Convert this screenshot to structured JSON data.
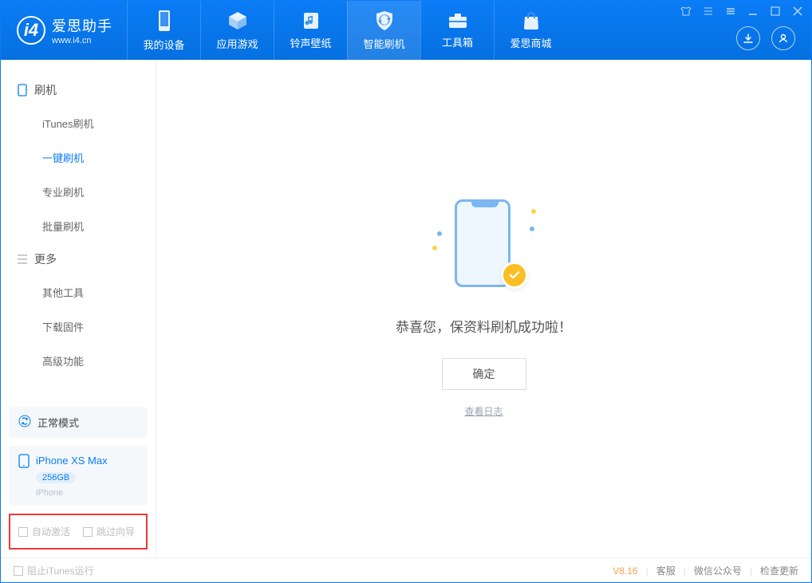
{
  "app": {
    "name_cn": "爱思助手",
    "name_en": "www.i4.cn"
  },
  "nav": {
    "device": "我的设备",
    "apps": "应用游戏",
    "ring": "铃声壁纸",
    "flash": "智能刷机",
    "toolbox": "工具箱",
    "store": "爱思商城"
  },
  "sections": {
    "flash": {
      "title": "刷机",
      "items": {
        "itunes": "iTunes刷机",
        "onekey": "一键刷机",
        "pro": "专业刷机",
        "batch": "批量刷机"
      }
    },
    "more": {
      "title": "更多",
      "items": {
        "other": "其他工具",
        "firmware": "下载固件",
        "advanced": "高级功能"
      }
    }
  },
  "mode_card": {
    "label": "正常模式"
  },
  "device_card": {
    "name": "iPhone XS Max",
    "capacity": "256GB",
    "type": "iPhone"
  },
  "options": {
    "auto_activate": "自动激活",
    "skip_guide": "跳过向导"
  },
  "result": {
    "message": "恭喜您，保资料刷机成功啦！",
    "ok": "确定",
    "view_log": "查看日志"
  },
  "footer": {
    "block_itunes": "阻止iTunes运行",
    "version": "V8.16",
    "service": "客服",
    "wechat": "微信公众号",
    "update": "检查更新"
  }
}
